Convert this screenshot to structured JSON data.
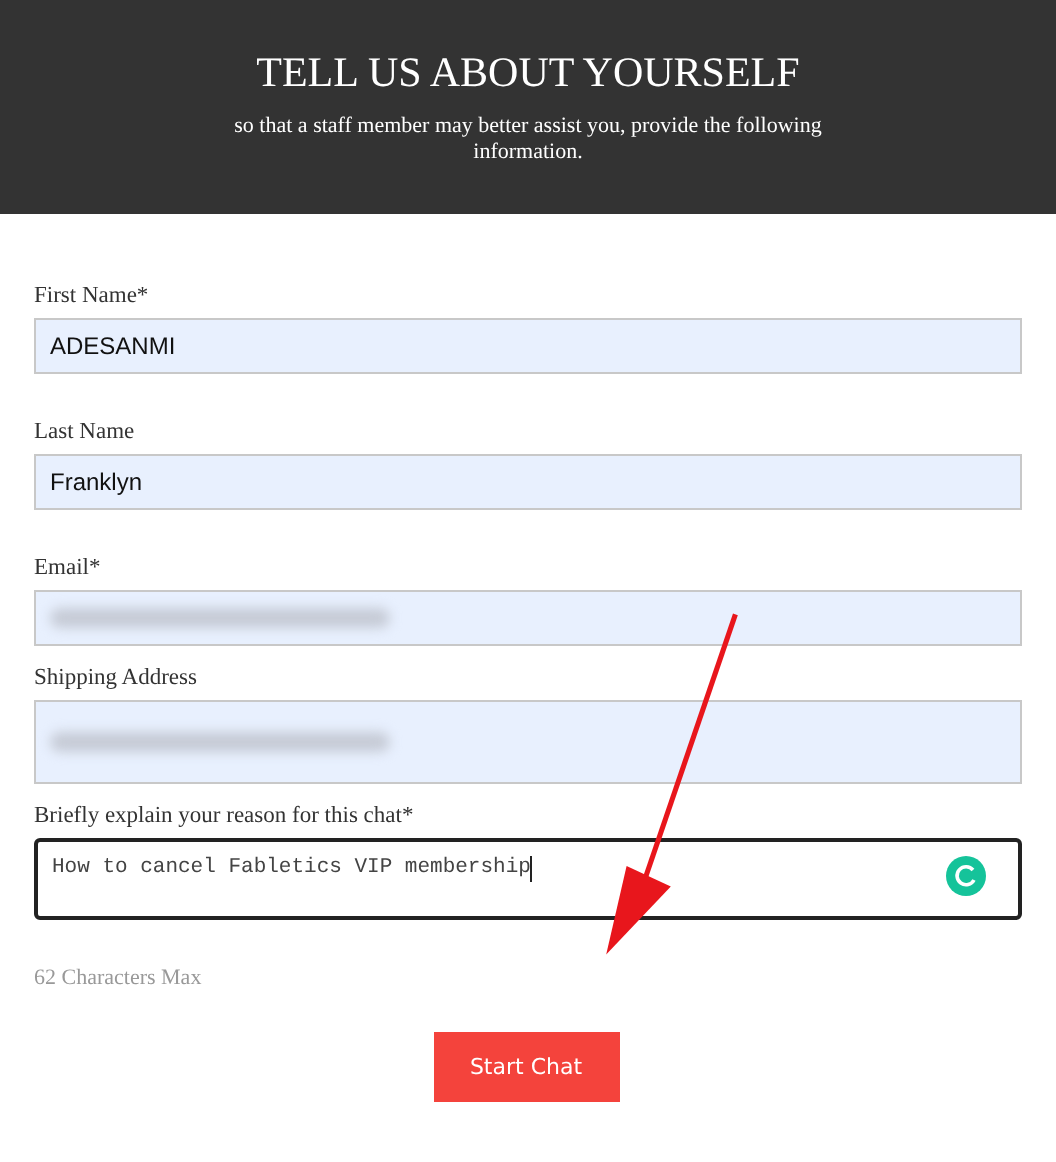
{
  "header": {
    "title": "TELL US ABOUT YOURSELF",
    "subtitle": "so that a staff member may better assist you, provide the following information."
  },
  "fields": [
    {
      "kind": "input",
      "label": "First Name*",
      "value": "ADESANMI",
      "redacted": false,
      "focused": false
    },
    {
      "kind": "input",
      "label": "Last Name",
      "value": "Franklyn",
      "redacted": false,
      "focused": false
    },
    {
      "kind": "input",
      "label": "Email*",
      "redacted": true,
      "focused": false
    },
    {
      "kind": "area",
      "label": "Shipping Address",
      "redacted": true,
      "focused": false
    },
    {
      "kind": "textarea",
      "label": "Briefly explain your reason for this chat*",
      "value": "How to cancel Fabletics VIP membership",
      "redacted": false,
      "focused": true
    }
  ],
  "hint": "62 Characters Max",
  "button": {
    "label": "Start Chat"
  },
  "arrow": {
    "color": "#e8161c"
  }
}
